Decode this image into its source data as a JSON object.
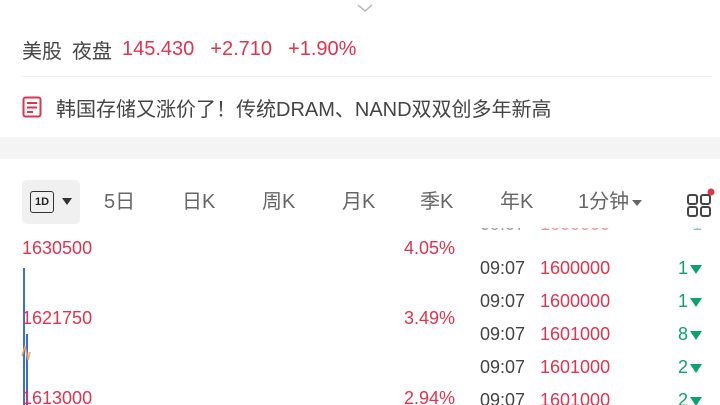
{
  "quote": {
    "market": "美股",
    "session": "夜盘",
    "price": "145.430",
    "change": "+2.710",
    "change_pct": "+1.90%"
  },
  "news": {
    "headline": "韩国存储又涨价了！传统DRAM、NAND双双创多年新高"
  },
  "tabs": {
    "active_label": "1D",
    "items": [
      "5日",
      "日K",
      "周K",
      "月K",
      "季K",
      "年K"
    ],
    "minute": "1分钟"
  },
  "chart": {
    "left_labels": [
      "1630500",
      "1621750",
      "1613000"
    ],
    "right_labels": [
      "4.05%",
      "3.49%",
      "2.94%"
    ]
  },
  "ticks": [
    {
      "time": "09:07",
      "price": "1600000",
      "vol": "1"
    },
    {
      "time": "09:07",
      "price": "1600000",
      "vol": "1"
    },
    {
      "time": "09:07",
      "price": "1601000",
      "vol": "8"
    },
    {
      "time": "09:07",
      "price": "1601000",
      "vol": "2"
    },
    {
      "time": "09:07",
      "price": "1601000",
      "vol": "2"
    }
  ],
  "colors": {
    "up": "#e0334e",
    "down": "#0aa36b",
    "accent_dot": "#e0334e"
  },
  "icons": [
    "chevron-down-icon",
    "news-icon",
    "grid-icon"
  ]
}
